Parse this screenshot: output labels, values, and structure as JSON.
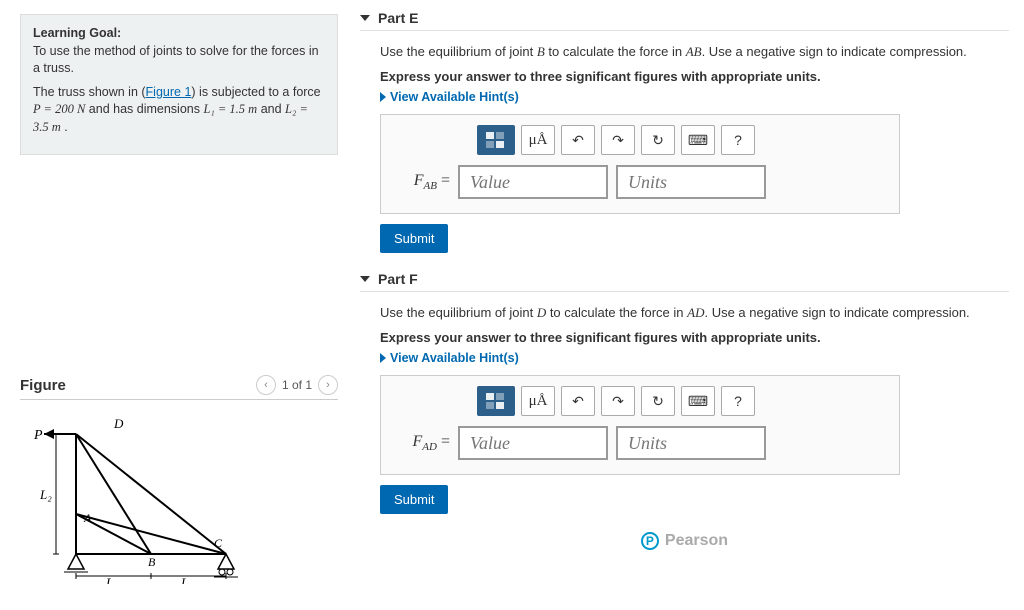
{
  "info": {
    "goal_label": "Learning Goal:",
    "goal_text": "To use the method of joints to solve for the forces in a truss.",
    "desc_pre": "The truss shown in (",
    "fig_link": "Figure 1",
    "desc_post": ") is subjected to a force ",
    "p_eq": "P = 200 N",
    "desc_dims": " and has dimensions ",
    "l1_eq": "L₁ = 1.5 m",
    "and": " and ",
    "l2_eq": "L₂ = 3.5 m",
    "period": " ."
  },
  "figure": {
    "title": "Figure",
    "pager": "1 of 1"
  },
  "partE": {
    "title": "Part E",
    "q_pre": "Use the equilibrium of joint ",
    "jB": "B",
    "q_mid": " to calculate the force in ",
    "AB": "AB",
    "q_post": ". Use a negative sign to indicate compression.",
    "bold": "Express your answer to three significant figures with appropriate units.",
    "hints": "View Available Hint(s)",
    "var": "F",
    "sub": "AB",
    "eq": " =",
    "value_ph": "Value",
    "units_ph": "Units",
    "submit": "Submit"
  },
  "partF": {
    "title": "Part F",
    "q_pre": "Use the equilibrium of joint ",
    "jD": "D",
    "q_mid": " to calculate the force in ",
    "AD": "AD",
    "q_post": ". Use a negative sign to indicate compression.",
    "bold": "Express your answer to three significant figures with appropriate units.",
    "hints": "View Available Hint(s)",
    "var": "F",
    "sub": "AD",
    "eq": " =",
    "value_ph": "Value",
    "units_ph": "Units",
    "submit": "Submit"
  },
  "toolbar": {
    "unit": "μÅ",
    "undo": "↶",
    "redo": "↷",
    "reset": "↻",
    "kbd": "⌨",
    "help": "?"
  },
  "footer": {
    "brand": "Pearson"
  }
}
